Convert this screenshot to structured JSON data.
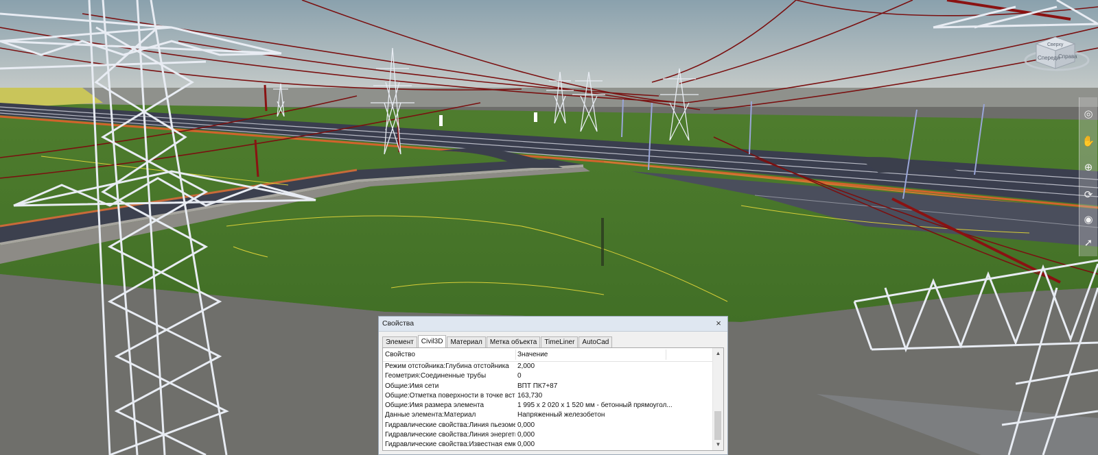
{
  "dialog": {
    "title": "Свойства",
    "close_glyph": "×",
    "tabs": [
      {
        "label": "Элемент",
        "active": false
      },
      {
        "label": "Civil3D",
        "active": true
      },
      {
        "label": "Материал",
        "active": false
      },
      {
        "label": "Метка объекта",
        "active": false
      },
      {
        "label": "TimeLiner",
        "active": false
      },
      {
        "label": "AutoCad",
        "active": false
      }
    ],
    "columns": [
      "Свойство",
      "Значение"
    ],
    "rows": [
      [
        "Режим отстойника:Глубина отстойника",
        "2,000"
      ],
      [
        "Геометрия:Соединенные трубы",
        "0"
      ],
      [
        "Общие:Имя сети",
        "ВПТ ПК7+87"
      ],
      [
        "Общие:Отметка поверхности в точке вста",
        "163,730"
      ],
      [
        "Общие:Имя размера элемента",
        "1 995 x 2 020 x 1 520 мм - бетонный прямоугол..."
      ],
      [
        "Данные элемента:Материал",
        "Напряженный железобетон"
      ],
      [
        "Гидравлические свойства:Линия пьезоме...",
        "0,000"
      ],
      [
        "Гидравлические свойства:Линия энергети...",
        "0,000"
      ],
      [
        "Гидравлические свойства:Известная емк...",
        "0,000"
      ]
    ],
    "scroll_up": "▲",
    "scroll_down": "▼"
  },
  "viewcube": {
    "face_top": "Сверху",
    "face_front": "Спереди",
    "face_right": "Справа"
  },
  "navbar": {
    "icons": [
      "steering-wheel-icon",
      "pan-hand-icon",
      "zoom-icon",
      "orbit-icon",
      "look-icon",
      "select-arrow-icon"
    ],
    "glyphs": [
      "◎",
      "✋",
      "⊕",
      "⟳",
      "◉",
      "➚"
    ]
  },
  "colors": {
    "sky_top": "#8aa1ad",
    "sky_bottom": "#c6cbc9",
    "ground": "#4a7a2c",
    "road": "#3a3e4e",
    "wire": "#7a1010",
    "tower": "#e8ecf3",
    "dialog_title_bg": "#dfe7f1"
  }
}
